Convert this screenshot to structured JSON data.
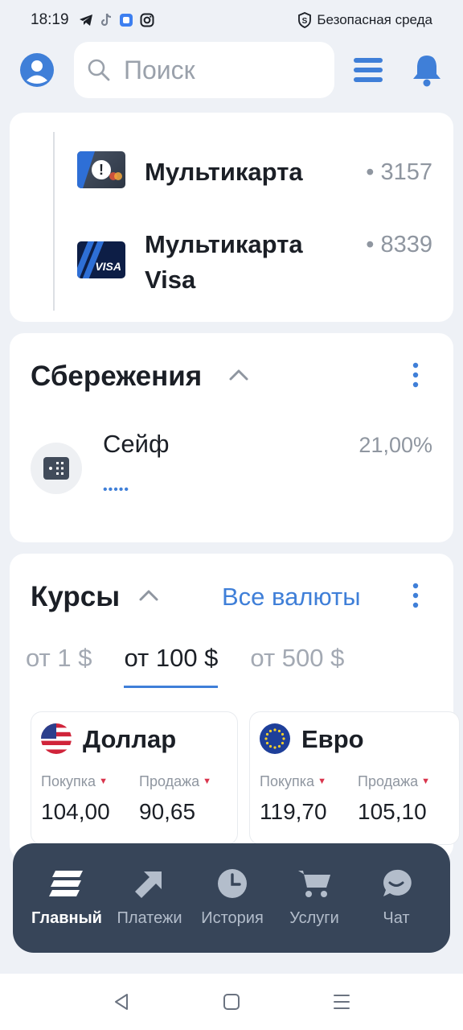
{
  "status_bar": {
    "time": "18:19",
    "safe_env": "Безопасная среда",
    "icons": [
      "telegram-icon",
      "tiktok-icon",
      "app-icon",
      "instagram-icon",
      "shield-icon"
    ]
  },
  "header": {
    "search_placeholder": "Поиск"
  },
  "accounts": [
    {
      "name": "Мультикарта",
      "number": "• 3157"
    },
    {
      "name": "Мультикарта Visa",
      "number": "• 8339",
      "badge": "VISA"
    }
  ],
  "savings": {
    "title": "Сбережения",
    "items": [
      {
        "name": "Сейф",
        "masked_balance": "•••••",
        "rate": "21,00%"
      }
    ]
  },
  "rates": {
    "title": "Курсы",
    "all_link": "Все валюты",
    "tabs": [
      "от 1 $",
      "от 100 $",
      "от 500 $"
    ],
    "active_tab": 1,
    "currencies": [
      {
        "name": "Доллар",
        "buy_label": "Покупка",
        "sell_label": "Продажа",
        "buy": "104,00",
        "sell": "90,65"
      },
      {
        "name": "Евро",
        "buy_label": "Покупка",
        "sell_label": "Продажа",
        "buy": "119,70",
        "sell": "105,10"
      }
    ]
  },
  "bottom_nav": [
    {
      "label": "Главный",
      "icon": "home-stack-icon",
      "active": true
    },
    {
      "label": "Платежи",
      "icon": "arrow-up-right-icon",
      "active": false
    },
    {
      "label": "История",
      "icon": "clock-icon",
      "active": false
    },
    {
      "label": "Услуги",
      "icon": "cart-icon",
      "active": false
    },
    {
      "label": "Чат",
      "icon": "chat-icon",
      "active": false
    }
  ],
  "colors": {
    "accent": "#3f7fd8",
    "nav_bg": "#374559",
    "down_marker": "#d9354d"
  }
}
